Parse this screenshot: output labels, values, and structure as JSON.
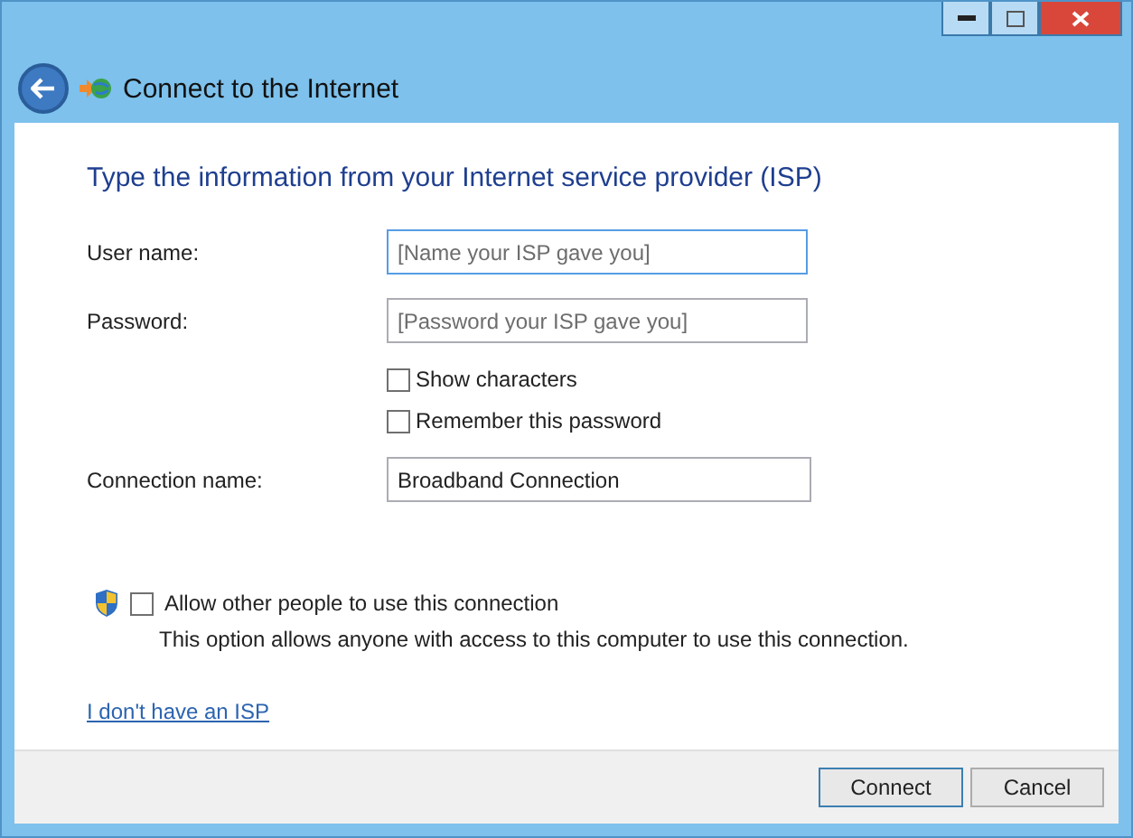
{
  "window": {
    "title": "Connect to the Internet"
  },
  "heading": "Type the information from your Internet service provider (ISP)",
  "fields": [
    {
      "label": "User name:",
      "placeholder": "[Name your ISP gave you]",
      "focused": true
    },
    {
      "label": "Password:",
      "placeholder": "[Password your ISP gave you]",
      "focused": false
    }
  ],
  "options": [
    {
      "label": "Show characters",
      "checked": false
    },
    {
      "label": "Remember this password",
      "checked": false
    }
  ],
  "connection_name": {
    "label": "Connection name:",
    "value": "Broadband Connection"
  },
  "sharing": {
    "label": "Allow other people to use this connection",
    "checked": false,
    "description": "This option allows anyone with access to this computer to use this connection."
  },
  "link": "I don't have an ISP",
  "buttons": [
    {
      "label": "Connect",
      "default": true
    },
    {
      "label": "Cancel",
      "default": false
    }
  ]
}
